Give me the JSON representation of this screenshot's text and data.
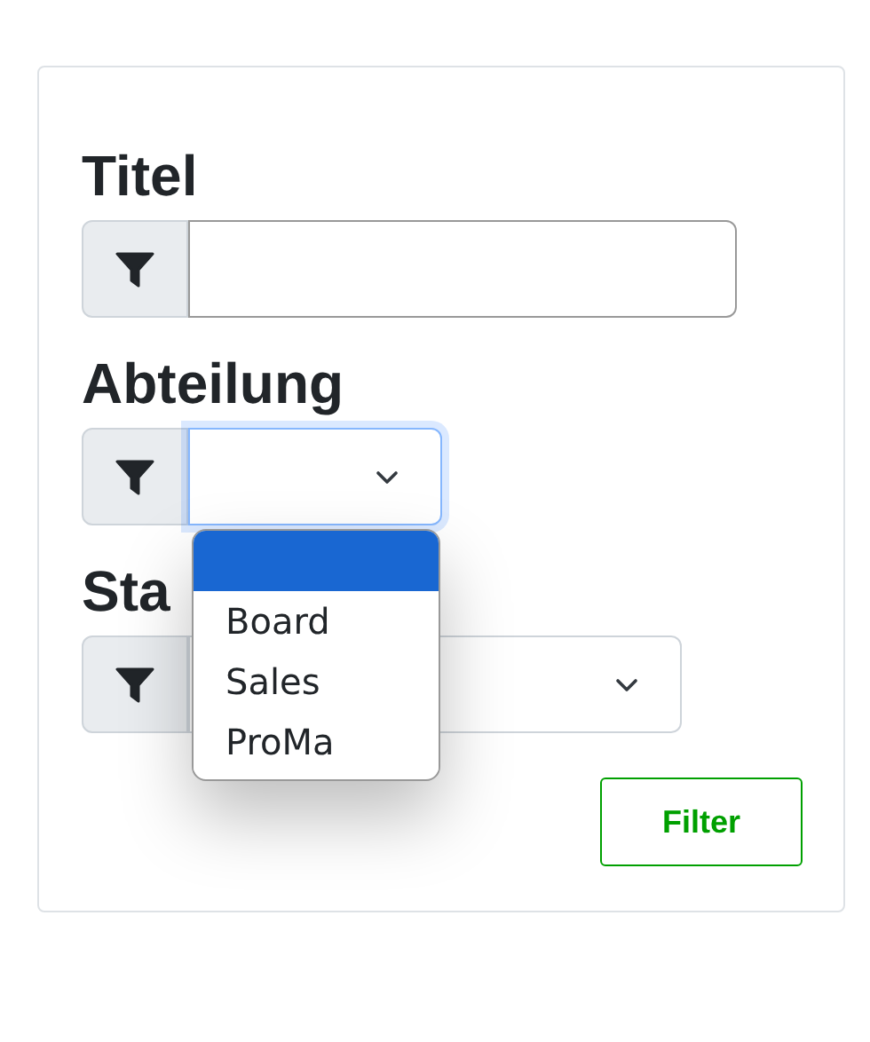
{
  "fields": [
    {
      "label": "Titel",
      "kind": "text"
    },
    {
      "label": "Abteilung",
      "kind": "select",
      "expanded": true,
      "options": [
        {
          "selected": true
        },
        {
          "label": "Board",
          "selected": false
        },
        {
          "label": "Sales",
          "selected": false
        },
        {
          "label": "ProMa",
          "selected": false
        }
      ]
    },
    {
      "label": "Sta",
      "kind": "select",
      "expanded": false
    }
  ],
  "button": "Filter"
}
